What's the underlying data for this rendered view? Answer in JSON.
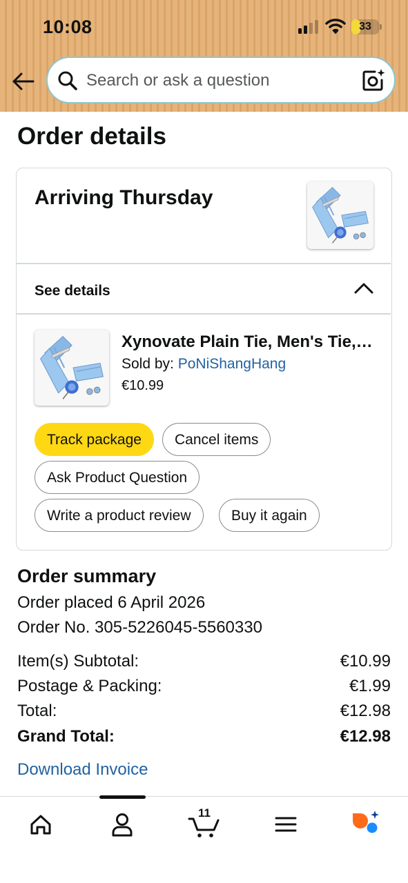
{
  "status_bar": {
    "time": "10:08",
    "battery": "33",
    "battery_level": 0.33
  },
  "header": {
    "search_placeholder": "Search or ask a question",
    "back_icon": "back-arrow-icon",
    "search_icon": "search-icon",
    "camera_icon": "camera-search-icon",
    "background_color": "#e6b47a"
  },
  "page": {
    "title": "Order details"
  },
  "shipment": {
    "status": "Arriving Thursday",
    "see_details_label": "See details",
    "item": {
      "title": "Xynovate Plain Tie, Men's Tie, Tie Clip, Pocket Square, Cufflinks and Brooch Set",
      "sold_by_label": "Sold by: ",
      "seller": "PoNiShangHang",
      "price": "€10.99"
    },
    "actions": {
      "track": "Track package",
      "cancel": "Cancel items",
      "ask": "Ask Product Question",
      "review": "Write a product review",
      "buy_again": "Buy it again"
    }
  },
  "summary": {
    "title": "Order summary",
    "order_placed": "Order placed 6 April 2026",
    "order_number": "Order No. 305-5226045-5560330",
    "rows": [
      {
        "label": "Item(s) Subtotal:",
        "value": "€10.99"
      },
      {
        "label": "Postage & Packing:",
        "value": "€1.99"
      },
      {
        "label": "Total:",
        "value": "€12.98"
      },
      {
        "label": "Grand Total:",
        "value": "€12.98"
      }
    ],
    "download_invoice": "Download Invoice"
  },
  "bottom_nav": {
    "items": [
      "home-icon",
      "account-icon",
      "cart-icon",
      "menu-icon",
      "assistant-icon"
    ],
    "cart_count": "11",
    "active": "account-icon"
  },
  "colors": {
    "accent_yellow": "#ffd814",
    "link_blue": "#2162a1",
    "border": "#d5d9d9"
  }
}
